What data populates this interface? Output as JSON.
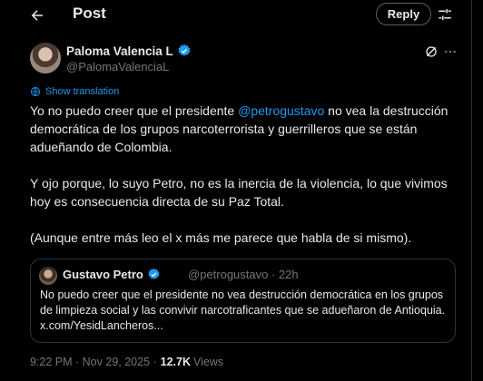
{
  "header": {
    "title": "Post",
    "reply_label": "Reply"
  },
  "author": {
    "name": "Paloma Valencia L",
    "handle": "@PalomaValenciaL"
  },
  "translation": {
    "label": "Show translation"
  },
  "post": {
    "p1_before": "Yo no puedo creer que el presidente ",
    "mention": "@petrogustavo",
    "p1_after": " no vea la destrucción democrática de los grupos narcoterrorista y guerrilleros que se están adueñando de Colombia.",
    "p2": "Y ojo porque, lo suyo Petro, no es la inercia de la violencia, lo que vivimos hoy es consecuencia directa de su Paz Total.",
    "p3": "(Aunque entre más leo el x más me parece que habla de si mismo)."
  },
  "quote": {
    "name": "Gustavo Petro",
    "handle": "@petrogustavo · 22h",
    "text": "No puedo creer que el presidente no vea destrucción democrática en los grupos de limpieza social y las convivir narcotraficantes que se adueñaron de Antioquia. x.com/YesidLancheros..."
  },
  "meta": {
    "timestamp": "9:22 PM · Nov 29, 2025 ·",
    "views_count": "12.7K",
    "views_label": "Views"
  },
  "colors": {
    "background": "#000000",
    "text": "#e7e9ea",
    "secondary": "#71767b",
    "accent": "#1d9bf0",
    "border": "#2f3336"
  },
  "icons": {
    "back": "arrow-left-icon",
    "filter": "sliders-icon",
    "verified": "verified-badge-icon",
    "grok": "grok-icon",
    "more": "more-horizontal-icon",
    "translate": "globe-icon"
  }
}
